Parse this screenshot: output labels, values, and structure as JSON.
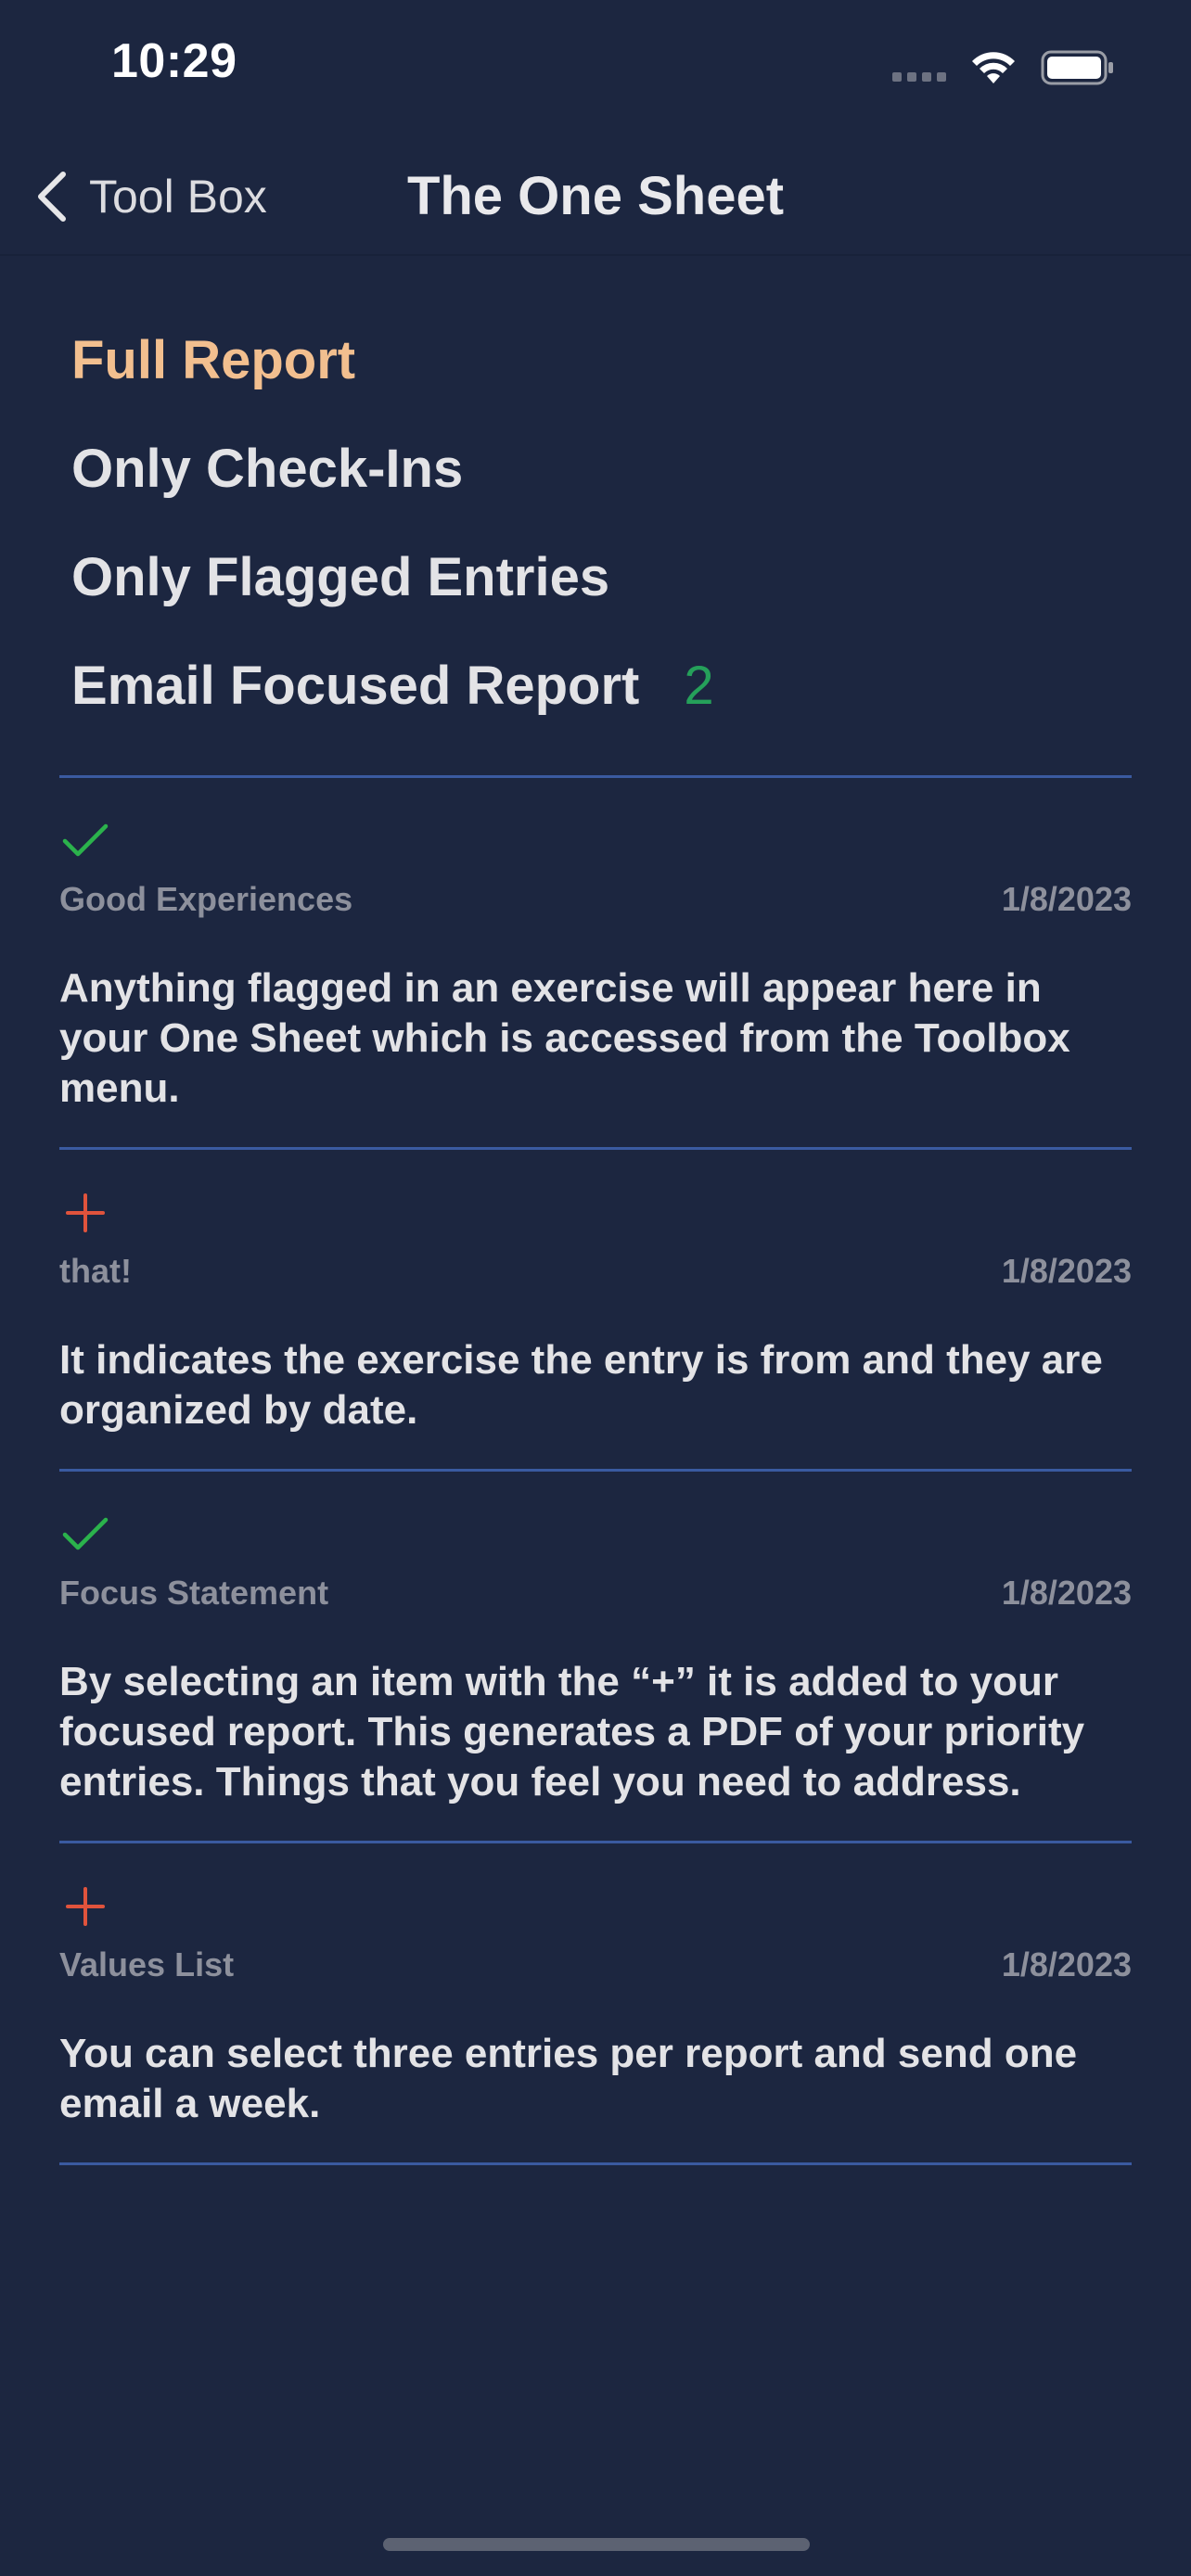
{
  "status_bar": {
    "time": "10:29"
  },
  "nav": {
    "back_label": "Tool Box",
    "title": "The One Sheet"
  },
  "report_options": [
    {
      "label": "Full Report",
      "active": true
    },
    {
      "label": "Only Check-Ins",
      "active": false
    },
    {
      "label": "Only Flagged Entries",
      "active": false
    },
    {
      "label": "Email Focused Report",
      "active": false,
      "count": "2"
    }
  ],
  "entries": [
    {
      "icon": "checkmark-icon",
      "category": "Good Experiences",
      "date": "1/8/2023",
      "text": "Anything flagged in an exercise will appear here in your One Sheet which is accessed from the Toolbox menu."
    },
    {
      "icon": "plus-icon",
      "category": "that!",
      "date": "1/8/2023",
      "text": "It indicates the exercise the entry is from and they are organized by date."
    },
    {
      "icon": "checkmark-icon",
      "category": "Focus Statement",
      "date": "1/8/2023",
      "text": "By selecting an item with the “+” it is added to your focused report. This generates a PDF of your priority entries. Things that you feel you need to address."
    },
    {
      "icon": "plus-icon",
      "category": "Values List",
      "date": "1/8/2023",
      "text": "You can select three entries per report and send one email a week."
    }
  ],
  "colors": {
    "background": "#1c2640",
    "accent_active": "#f2bf8f",
    "check_green": "#2bb24c",
    "plus_red": "#e0533c",
    "count_green": "#25a05a",
    "divider": "#3a5aa0"
  }
}
